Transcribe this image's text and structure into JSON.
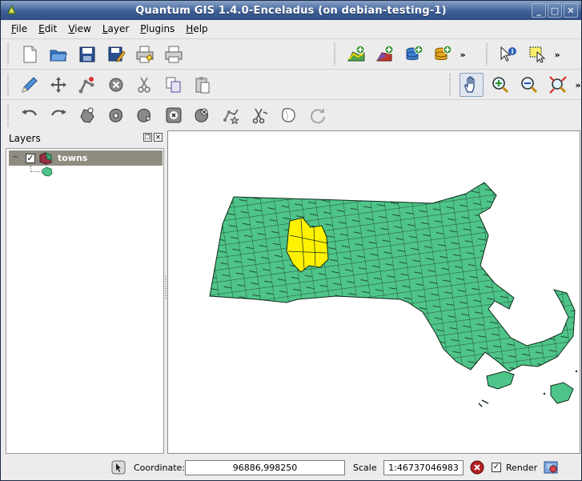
{
  "window": {
    "title": "Quantum GIS 1.4.0-Enceladus (on debian-testing-1)"
  },
  "menu": [
    {
      "label": "File",
      "key": "F",
      "rest": "ile"
    },
    {
      "label": "Edit",
      "key": "E",
      "rest": "dit"
    },
    {
      "label": "View",
      "key": "V",
      "rest": "iew"
    },
    {
      "label": "Layer",
      "key": "L",
      "rest": "ayer"
    },
    {
      "label": "Plugins",
      "key": "P",
      "rest": "lugins"
    },
    {
      "label": "Help",
      "key": "H",
      "rest": "elp"
    }
  ],
  "dock": {
    "title": "Layers"
  },
  "layers": [
    {
      "name": "towns",
      "visible": true
    }
  ],
  "status": {
    "coordinate_label": "Coordinate:",
    "coordinate_value": "96886,998250",
    "scale_label": "Scale",
    "scale_value": "1:46737046983",
    "render_label": "Render",
    "render_checked": true
  },
  "colors": {
    "feature_fill": "#4fc489",
    "selected_fill": "#fff200",
    "titlebar": "#3e5f95",
    "layer_row": "#8f8c82"
  }
}
